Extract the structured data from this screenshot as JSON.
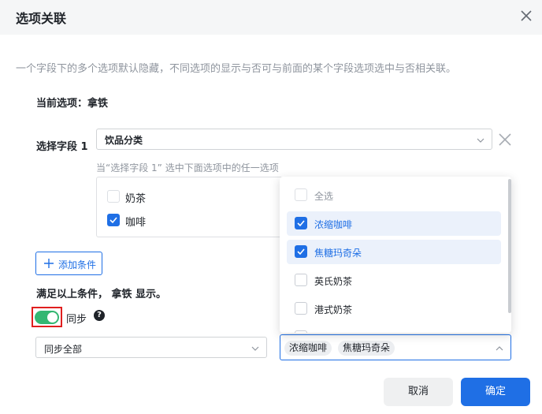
{
  "dialog": {
    "title": "选项关联",
    "description": "一个字段下的多个选项默认隐藏，不同选项的显示与否可与前面的某个字段选项选中与否相关联。",
    "current_option": "当前选项：拿铁"
  },
  "condition": {
    "field_label": "选择字段 1",
    "field_value": "饮品分类",
    "hint": "当“选择字段 1” 选中下面选项中的任一选项",
    "options": [
      {
        "label": "奶茶",
        "checked": false
      },
      {
        "label": "咖啡",
        "checked": true
      }
    ],
    "add_label": "添加条件"
  },
  "result": {
    "text": "满足以上条件， 拿铁 显示。",
    "sync_label": "同步",
    "sync_enabled": true,
    "sync_scope": "同步全部",
    "selected_tags": [
      "浓缩咖啡",
      "焦糖玛奇朵"
    ]
  },
  "dropdown": {
    "items": [
      {
        "label": "全选",
        "checked": false
      },
      {
        "label": "浓缩咖啡",
        "checked": true
      },
      {
        "label": "焦糖玛奇朵",
        "checked": true
      },
      {
        "label": "英氏奶茶",
        "checked": false
      },
      {
        "label": "港式奶茶",
        "checked": false
      }
    ]
  },
  "footer": {
    "cancel_label": "取消",
    "confirm_label": "确定"
  },
  "colors": {
    "accent": "#1f6fe5",
    "toggle_on": "#34b772",
    "highlight_frame": "#e01f1f"
  }
}
